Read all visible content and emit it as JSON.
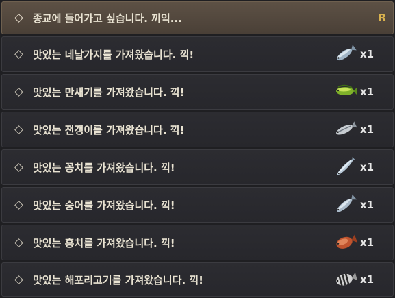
{
  "header": {
    "title": "종교에 들어가고 싶습니다. 끼익...",
    "badge": "R"
  },
  "items": [
    {
      "label": "맛있는 네날가지를 가져왔습니다. 끽!",
      "qty": "x1",
      "icon": "blue-fish-icon"
    },
    {
      "label": "맛있는 만새기를 가져왔습니다. 끽!",
      "qty": "x1",
      "icon": "mahi-mahi-icon"
    },
    {
      "label": "맛있는 전갱이를 가져왔습니다. 끽!",
      "qty": "x1",
      "icon": "horse-mackerel-icon"
    },
    {
      "label": "맛있는 꽁치를 가져왔습니다. 끽!",
      "qty": "x1",
      "icon": "saury-icon"
    },
    {
      "label": "맛있는 숭어를 가져왔습니다. 끽!",
      "qty": "x1",
      "icon": "mullet-icon"
    },
    {
      "label": "맛있는 흥치를 가져왔습니다. 끽!",
      "qty": "x1",
      "icon": "red-fish-icon"
    },
    {
      "label": "맛있는 해포리고기를 가져왔습니다. 끽!",
      "qty": "x1",
      "icon": "striped-fish-icon"
    }
  ]
}
